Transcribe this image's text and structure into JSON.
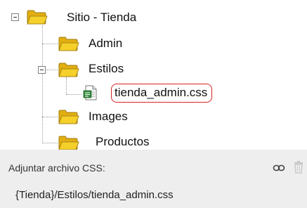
{
  "tree": {
    "root": {
      "label": "Sitio - Tienda",
      "icon": "folder-open-icon"
    },
    "items": [
      {
        "label": "Admin",
        "icon": "folder-icon"
      },
      {
        "label": "Estilos",
        "icon": "folder-open-icon"
      },
      {
        "label": "tienda_admin.css",
        "icon": "css-file-icon",
        "selected": true
      },
      {
        "label": "Images",
        "icon": "folder-icon"
      },
      {
        "label": "Productos",
        "icon": "folder-icon"
      }
    ],
    "highlight_color": "#d82222",
    "folder_color": "#f2c919"
  },
  "attach_panel": {
    "label": "Adjuntar archivo CSS:",
    "value": "{Tienda}/Estilos/tienda_admin.css",
    "link_icon": "link-icon",
    "delete_icon": "trash-icon"
  }
}
